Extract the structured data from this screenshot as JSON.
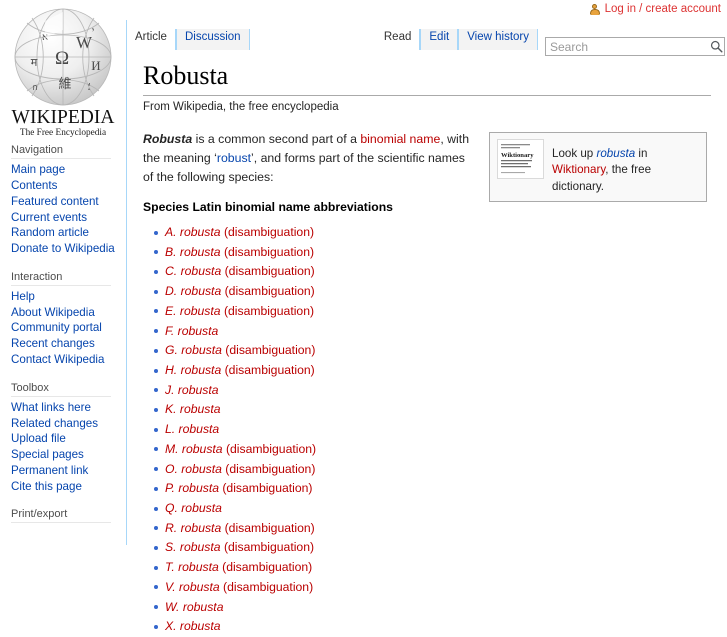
{
  "personal": {
    "login_label": "Log in / create account",
    "user_icon": "user-avatar-icon"
  },
  "logo": {
    "wordmark": "WIKIPEDIA",
    "tagline": "The Free Encyclopedia",
    "globe_glyphs": [
      "W",
      "Ω",
      "И",
      "維",
      "ג",
      "अ"
    ]
  },
  "sidebar": {
    "sections": [
      {
        "heading": "Navigation",
        "items": [
          "Main page",
          "Contents",
          "Featured content",
          "Current events",
          "Random article",
          "Donate to Wikipedia"
        ]
      },
      {
        "heading": "Interaction",
        "items": [
          "Help",
          "About Wikipedia",
          "Community portal",
          "Recent changes",
          "Contact Wikipedia"
        ]
      },
      {
        "heading": "Toolbox",
        "items": [
          "What links here",
          "Related changes",
          "Upload file",
          "Special pages",
          "Permanent link",
          "Cite this page"
        ]
      },
      {
        "heading": "Print/export",
        "items": []
      }
    ]
  },
  "tabs": {
    "namespace": [
      {
        "label": "Article",
        "selected": true
      },
      {
        "label": "Discussion",
        "selected": false
      }
    ],
    "views": [
      {
        "label": "Read",
        "selected": true
      },
      {
        "label": "Edit",
        "selected": false
      },
      {
        "label": "View history",
        "selected": false
      }
    ]
  },
  "search": {
    "placeholder": "Search",
    "value": "",
    "icon": "magnifier-icon"
  },
  "article": {
    "title": "Robusta",
    "sitesub": "From Wikipedia, the free encyclopedia",
    "lead": {
      "term": "Robusta",
      "part1": " is a common second part of a ",
      "link_binomial": "binomial name",
      "part2": ", with the meaning ‘",
      "link_robust": "robust",
      "part3": "’, and forms part of the scientific names of the following species:"
    },
    "abbrev_heading": "Species Latin binomial name abbreviations",
    "species": [
      {
        "name": "A. robusta",
        "suffix": " (disambiguation)"
      },
      {
        "name": "B. robusta",
        "suffix": " (disambiguation)"
      },
      {
        "name": "C. robusta",
        "suffix": " (disambiguation)"
      },
      {
        "name": "D. robusta",
        "suffix": " (disambiguation)"
      },
      {
        "name": "E. robusta",
        "suffix": " (disambiguation)"
      },
      {
        "name": "F. robusta",
        "suffix": ""
      },
      {
        "name": "G. robusta",
        "suffix": " (disambiguation)"
      },
      {
        "name": "H. robusta",
        "suffix": " (disambiguation)"
      },
      {
        "name": "J. robusta",
        "suffix": ""
      },
      {
        "name": "K. robusta",
        "suffix": ""
      },
      {
        "name": "L. robusta",
        "suffix": ""
      },
      {
        "name": "M. robusta",
        "suffix": " (disambiguation)"
      },
      {
        "name": "O. robusta",
        "suffix": " (disambiguation)"
      },
      {
        "name": "P. robusta",
        "suffix": " (disambiguation)"
      },
      {
        "name": "Q. robusta",
        "suffix": ""
      },
      {
        "name": "R. robusta",
        "suffix": " (disambiguation)"
      },
      {
        "name": "S. robusta",
        "suffix": " (disambiguation)"
      },
      {
        "name": "T. robusta",
        "suffix": " (disambiguation)"
      },
      {
        "name": "V. robusta",
        "suffix": " (disambiguation)"
      },
      {
        "name": "W. robusta",
        "suffix": ""
      },
      {
        "name": "X. robusta",
        "suffix": ""
      }
    ]
  },
  "wiktionary_box": {
    "logo_title": "Wiktionary",
    "logo_lines": [
      "a free-language, free",
      "encyclopedia",
      "[ˈwɪkʃənəri] n.",
      "a wiki-based Open",
      "Content dictionary",
      "Wikimedia Foundation"
    ],
    "text_part1": "Look up ",
    "term": "robusta",
    "text_part2": " in ",
    "link_wiktionary": "Wiktionary",
    "text_part3": ", the free dictionary."
  },
  "colors": {
    "link_blue": "#0645ad",
    "link_red": "#ba0000",
    "personal_red": "#dd3333",
    "tab_border": "#a7d7f9",
    "tab_inactive_bg": "#f3f3f3",
    "bullet_blue": "#3366cc"
  }
}
